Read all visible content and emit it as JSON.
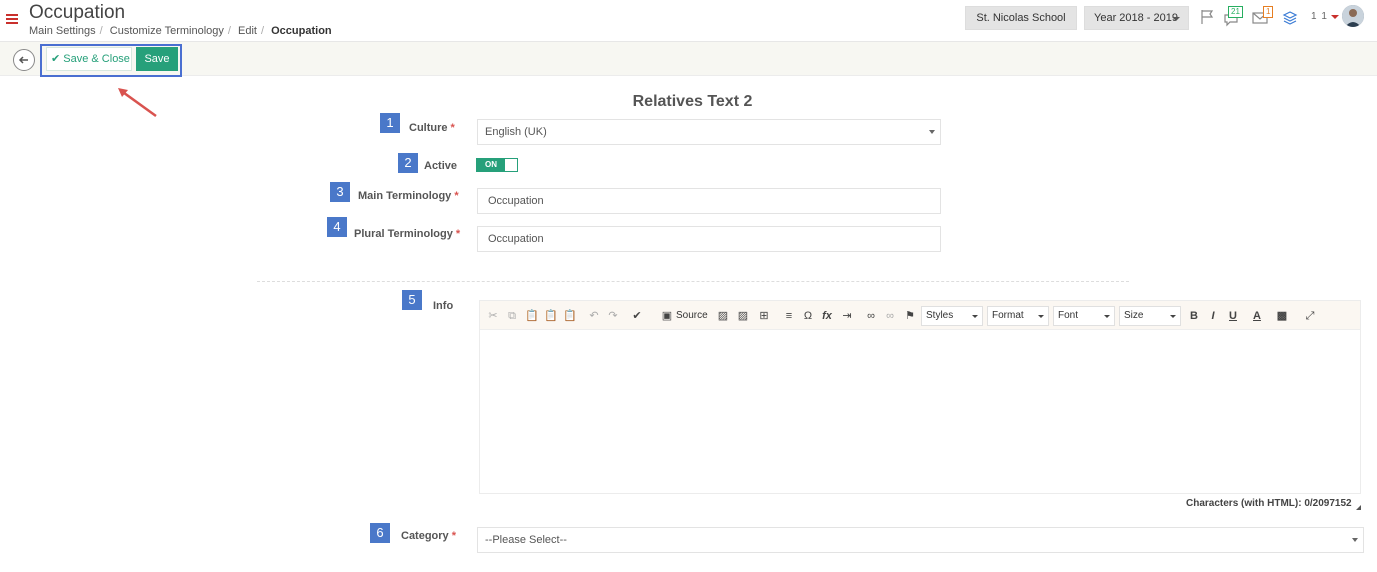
{
  "header": {
    "title": "Occupation",
    "breadcrumb": [
      "Main Settings",
      "Customize Terminology",
      "Edit",
      "Occupation"
    ],
    "school": "St. Nicolas School",
    "year": "Year 2018 - 2019",
    "notifications": {
      "messages_count": "21",
      "mail_count": "1"
    },
    "user_label": "1 1",
    "icons": [
      "hamburger-icon",
      "flag-icon",
      "chat-icon",
      "mail-icon",
      "layers-icon"
    ]
  },
  "toolbar": {
    "save_close_label": "Save & Close",
    "save_label": "Save"
  },
  "form": {
    "title": "Relatives Text 2",
    "fields": [
      {
        "num": "1",
        "label": "Culture",
        "required": true,
        "value": "English (UK)"
      },
      {
        "num": "2",
        "label": "Active",
        "required": false,
        "value": "ON"
      },
      {
        "num": "3",
        "label": "Main Terminology",
        "required": true,
        "value": "Occupation"
      },
      {
        "num": "4",
        "label": "Plural Terminology",
        "required": true,
        "value": "Occupation"
      },
      {
        "num": "5",
        "label": "Info",
        "required": false
      },
      {
        "num": "6",
        "label": "Category",
        "required": true,
        "value": "--Please Select--"
      }
    ],
    "required_mark": "*"
  },
  "editor": {
    "source_label": "Source",
    "styles_label": "Styles",
    "format_label": "Format",
    "font_label": "Font",
    "size_label": "Size",
    "char_count": "Characters (with HTML): 0/2097152"
  },
  "colors": {
    "accent": "#26a07a",
    "badge": "#4a78c9",
    "required": "#d9534f",
    "highlight": "#4a6fd1"
  }
}
